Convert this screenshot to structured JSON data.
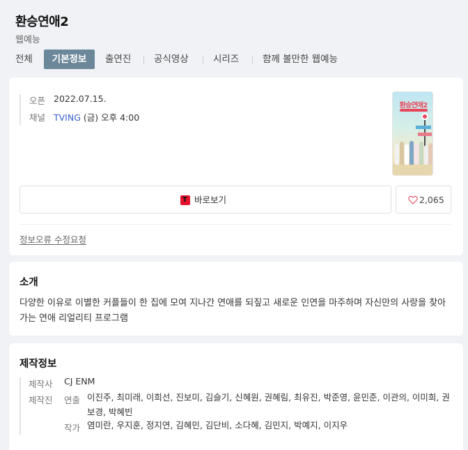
{
  "header": {
    "title": "환승연애2",
    "subtitle": "웹예능"
  },
  "tabs": [
    {
      "label": "전체",
      "active": false
    },
    {
      "label": "기본정보",
      "active": true
    },
    {
      "label": "출연진",
      "active": false
    },
    {
      "label": "공식영상",
      "active": false
    },
    {
      "label": "시리즈",
      "active": false
    },
    {
      "label": "함께 볼만한 웹예능",
      "active": false
    }
  ],
  "basic_info": {
    "premiere_label": "오픈",
    "premiere_value": "2022.07.15.",
    "channel_label": "채널",
    "channel_name": "TVING",
    "channel_schedule": "(금) 오후 4:00",
    "poster_text": "환승연애2",
    "watch_label": "바로보기",
    "watch_icon": "tving-logo-icon",
    "like_icon": "heart-outline-icon",
    "like_count": "2,065",
    "report_link": "정보오류 수정요청"
  },
  "intro": {
    "title": "소개",
    "text": "다양한 이유로 이별한 커플들이 한 집에 모여 지나간 연애를 되짚고 새로운 인연을 마주하며 자신만의 사랑을 찾아가는 연애 리얼리티 프로그램"
  },
  "production": {
    "title": "제작정보",
    "producer_label": "제작사",
    "producer_value": "CJ ENM",
    "staff_label": "제작진",
    "director_label": "연출",
    "director_value": "이진주, 최미래, 이희선, 진보미, 김슬기, 신혜원, 권혜림, 최유진, 박준영, 윤민준, 이관의, 이미희, 권보경, 박혜빈",
    "writer_label": "작가",
    "writer_value": "염미란, 우지훈, 정지연, 김혜민, 김단비, 소다혜, 김민지, 박예지, 이지우"
  },
  "colors": {
    "active_tab_bg": "#6b8799",
    "link": "#3a5fcd",
    "tving_red": "#e3132c",
    "heart": "#e25563"
  }
}
